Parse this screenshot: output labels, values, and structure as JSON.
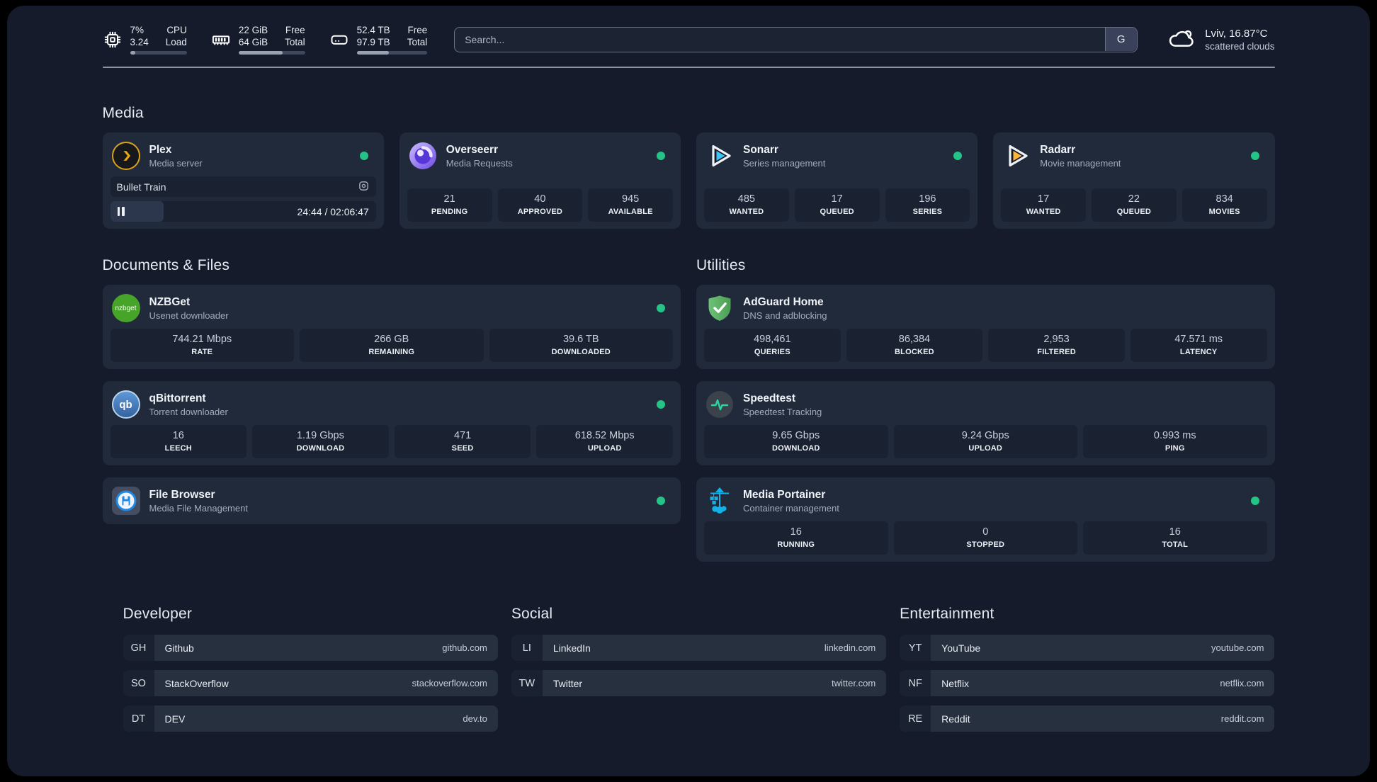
{
  "colors": {
    "status_online": "#23c486",
    "background": "#151b2b",
    "card": "#212a3a"
  },
  "header": {
    "resources": [
      {
        "icon": "cpu-icon",
        "values": [
          "7%",
          "3.24"
        ],
        "labels": [
          "CPU",
          "Load"
        ],
        "progress_pct": 9
      },
      {
        "icon": "memory-icon",
        "values": [
          "22 GiB",
          "64 GiB"
        ],
        "labels": [
          "Free",
          "Total"
        ],
        "progress_pct": 66
      },
      {
        "icon": "disk-icon",
        "values": [
          "52.4 TB",
          "97.9 TB"
        ],
        "labels": [
          "Free",
          "Total"
        ],
        "progress_pct": 46
      }
    ],
    "search": {
      "placeholder": "Search...",
      "engine_button": "G"
    },
    "weather": {
      "location": "Lviv, 16.87°C",
      "condition": "scattered clouds"
    }
  },
  "media": {
    "heading": "Media",
    "plex": {
      "title": "Plex",
      "subtitle": "Media server",
      "now_playing": {
        "title": "Bullet Train",
        "elapsed_total": "24:44 / 02:06:47",
        "progress_pct": 20
      }
    },
    "overseerr": {
      "title": "Overseerr",
      "subtitle": "Media Requests",
      "stats": [
        {
          "value": "21",
          "label": "PENDING"
        },
        {
          "value": "40",
          "label": "APPROVED"
        },
        {
          "value": "945",
          "label": "AVAILABLE"
        }
      ]
    },
    "sonarr": {
      "title": "Sonarr",
      "subtitle": "Series management",
      "stats": [
        {
          "value": "485",
          "label": "WANTED"
        },
        {
          "value": "17",
          "label": "QUEUED"
        },
        {
          "value": "196",
          "label": "SERIES"
        }
      ]
    },
    "radarr": {
      "title": "Radarr",
      "subtitle": "Movie management",
      "stats": [
        {
          "value": "17",
          "label": "WANTED"
        },
        {
          "value": "22",
          "label": "QUEUED"
        },
        {
          "value": "834",
          "label": "MOVIES"
        }
      ]
    }
  },
  "documents": {
    "heading": "Documents & Files",
    "nzbget": {
      "title": "NZBGet",
      "subtitle": "Usenet downloader",
      "icon_text": "nzbget",
      "stats": [
        {
          "value": "744.21 Mbps",
          "label": "RATE"
        },
        {
          "value": "266 GB",
          "label": "REMAINING"
        },
        {
          "value": "39.6 TB",
          "label": "DOWNLOADED"
        }
      ]
    },
    "qbittorrent": {
      "title": "qBittorrent",
      "subtitle": "Torrent downloader",
      "icon_text": "qb",
      "stats": [
        {
          "value": "16",
          "label": "LEECH"
        },
        {
          "value": "1.19 Gbps",
          "label": "DOWNLOAD"
        },
        {
          "value": "471",
          "label": "SEED"
        },
        {
          "value": "618.52 Mbps",
          "label": "UPLOAD"
        }
      ]
    },
    "filebrowser": {
      "title": "File Browser",
      "subtitle": "Media File Management"
    }
  },
  "utilities": {
    "heading": "Utilities",
    "adguard": {
      "title": "AdGuard Home",
      "subtitle": "DNS and adblocking",
      "stats": [
        {
          "value": "498,461",
          "label": "QUERIES"
        },
        {
          "value": "86,384",
          "label": "BLOCKED"
        },
        {
          "value": "2,953",
          "label": "FILTERED"
        },
        {
          "value": "47.571 ms",
          "label": "LATENCY"
        }
      ]
    },
    "speedtest": {
      "title": "Speedtest",
      "subtitle": "Speedtest Tracking",
      "stats": [
        {
          "value": "9.65 Gbps",
          "label": "DOWNLOAD"
        },
        {
          "value": "9.24 Gbps",
          "label": "UPLOAD"
        },
        {
          "value": "0.993 ms",
          "label": "PING"
        }
      ]
    },
    "portainer": {
      "title": "Media Portainer",
      "subtitle": "Container management",
      "stats": [
        {
          "value": "16",
          "label": "RUNNING"
        },
        {
          "value": "0",
          "label": "STOPPED"
        },
        {
          "value": "16",
          "label": "TOTAL"
        }
      ]
    }
  },
  "bookmarks": {
    "developer": {
      "heading": "Developer",
      "items": [
        {
          "abbr": "GH",
          "name": "Github",
          "domain": "github.com"
        },
        {
          "abbr": "SO",
          "name": "StackOverflow",
          "domain": "stackoverflow.com"
        },
        {
          "abbr": "DT",
          "name": "DEV",
          "domain": "dev.to"
        }
      ]
    },
    "social": {
      "heading": "Social",
      "items": [
        {
          "abbr": "LI",
          "name": "LinkedIn",
          "domain": "linkedin.com"
        },
        {
          "abbr": "TW",
          "name": "Twitter",
          "domain": "twitter.com"
        }
      ]
    },
    "entertainment": {
      "heading": "Entertainment",
      "items": [
        {
          "abbr": "YT",
          "name": "YouTube",
          "domain": "youtube.com"
        },
        {
          "abbr": "NF",
          "name": "Netflix",
          "domain": "netflix.com"
        },
        {
          "abbr": "RE",
          "name": "Reddit",
          "domain": "reddit.com"
        }
      ]
    }
  }
}
